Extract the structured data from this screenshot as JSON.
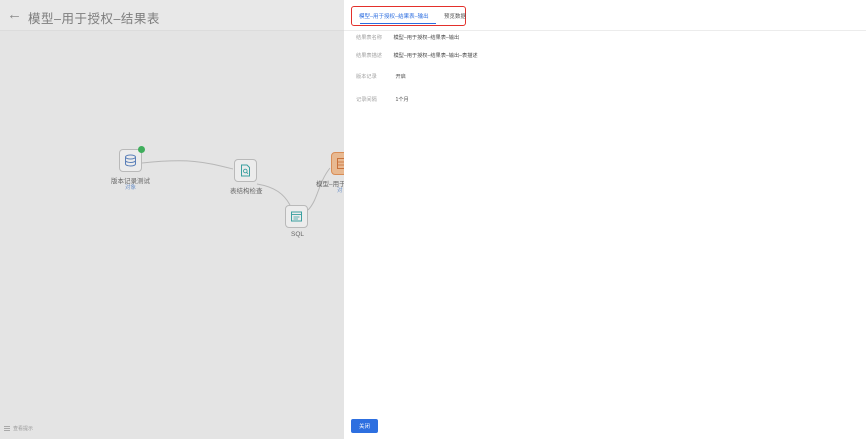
{
  "header": {
    "back_icon": "arrow-left-icon",
    "title": "模型–用于授权–结果表"
  },
  "nodes": [
    {
      "label": "版本记录测试",
      "sub": "对象",
      "icon": "database-icon",
      "status": "success"
    },
    {
      "label": "表结构检查",
      "icon": "document-search-icon"
    },
    {
      "label": "SQL",
      "icon": "sql-window-icon"
    },
    {
      "label": "模型–用于",
      "sub": "对",
      "icon": "table-icon"
    }
  ],
  "footer": {
    "hint": "查看提示",
    "icon": "list-icon"
  },
  "drawer": {
    "tabs": [
      {
        "label": "模型–用于授权–结果表–输出",
        "active": true
      },
      {
        "label": "预览数据",
        "active": false
      }
    ],
    "fields": [
      {
        "key": "结果表名称",
        "value": "模型–用于授权–结果表–输出"
      },
      {
        "key": "结果表描述",
        "value": "模型–用于授权–结果表–输出–表描述"
      },
      {
        "key": "版本记录",
        "value": "开启"
      },
      {
        "key": "记录间隔",
        "value": "1个月"
      }
    ],
    "close_label": "关闭"
  },
  "colors": {
    "primary": "#2d6fe0",
    "highlight_border": "#e3302b",
    "success": "#3fae5c",
    "output_node": "#e8b991"
  }
}
